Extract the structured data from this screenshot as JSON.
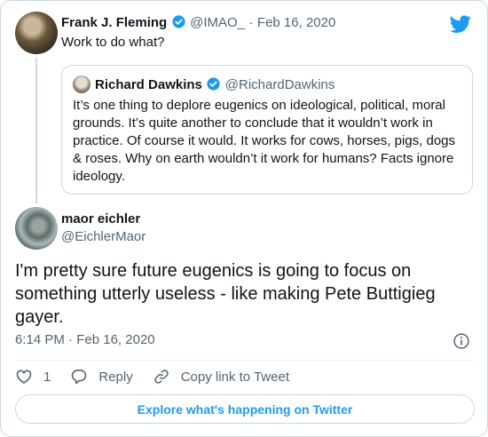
{
  "colors": {
    "accent": "#1d9bf0",
    "muted": "#536471",
    "border": "#cfd9de",
    "text": "#0f1419"
  },
  "parent_tweet": {
    "author_name": "Frank J. Fleming",
    "handle": "@IMAO_",
    "separator": "·",
    "date": "Feb 16, 2020",
    "text": "Work to do what?",
    "verified_icon": "verified-badge-icon"
  },
  "quoted_tweet": {
    "author_name": "Richard Dawkins",
    "handle": "@RichardDawkins",
    "text": "It’s one thing to deplore eugenics on ideological, political, moral grounds. It’s quite another to conclude that it wouldn’t work in practice. Of course it would. It works for cows, horses, pigs, dogs & roses. Why on earth wouldn’t it work for humans? Facts ignore ideology.",
    "verified_icon": "verified-badge-icon"
  },
  "main_tweet": {
    "author_name": "maor eichler",
    "handle": "@EichlerMaor",
    "text": "I'm pretty sure future eugenics is going to focus on something utterly useless - like making Pete Buttigieg gayer.",
    "time": "6:14 PM",
    "separator": "·",
    "date": "Feb 16, 2020"
  },
  "actions": {
    "like_count": "1",
    "reply_label": "Reply",
    "copy_link_label": "Copy link to Tweet"
  },
  "footer": {
    "explore_label": "Explore what's happening on Twitter"
  },
  "icons": [
    "twitter-bird-icon",
    "heart-icon",
    "reply-icon",
    "link-icon",
    "info-icon"
  ]
}
